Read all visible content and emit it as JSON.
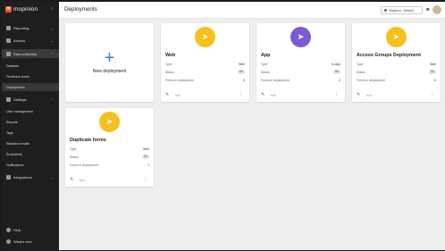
{
  "app": {
    "logo_text": "mopinion",
    "logo_mark": "m"
  },
  "sidebar": {
    "collapse_icon": "chevron-left-icon",
    "items": [
      {
        "label": "Reporting",
        "icon": "chart-icon"
      },
      {
        "label": "Actions",
        "icon": "actions-icon"
      },
      {
        "label": "Data collection",
        "icon": "data-icon"
      },
      {
        "label": "Settings",
        "icon": "gear-icon"
      },
      {
        "label": "Integrations",
        "icon": "plug-icon"
      }
    ],
    "data_sub": [
      "Datasets",
      "Feedback forms",
      "Deployments"
    ],
    "settings_sub": [
      "User management",
      "Reports",
      "Tags",
      "Standard emails",
      "Emailalerts",
      "Notifications"
    ],
    "bottom": [
      "Help",
      "What's new"
    ]
  },
  "header": {
    "title": "Deployments",
    "account": "Mopinion - Default"
  },
  "new_card": {
    "label": "New deployment"
  },
  "labels": {
    "type": "Type",
    "status": "Status",
    "forms": "Forms in deployment"
  },
  "deployments": [
    {
      "name": "Web",
      "type": "Web",
      "status": "On",
      "forms": "0",
      "color": "yellow"
    },
    {
      "name": "App",
      "type": "In-App",
      "status": "On",
      "forms": "2",
      "color": "purple"
    },
    {
      "name": "Access Groups Deployment",
      "type": "Web",
      "status": "On",
      "forms": "0",
      "color": "yellow"
    },
    {
      "name": "Duplicate forms",
      "type": "Web",
      "status": "On",
      "forms": "1",
      "color": "yellow"
    }
  ]
}
